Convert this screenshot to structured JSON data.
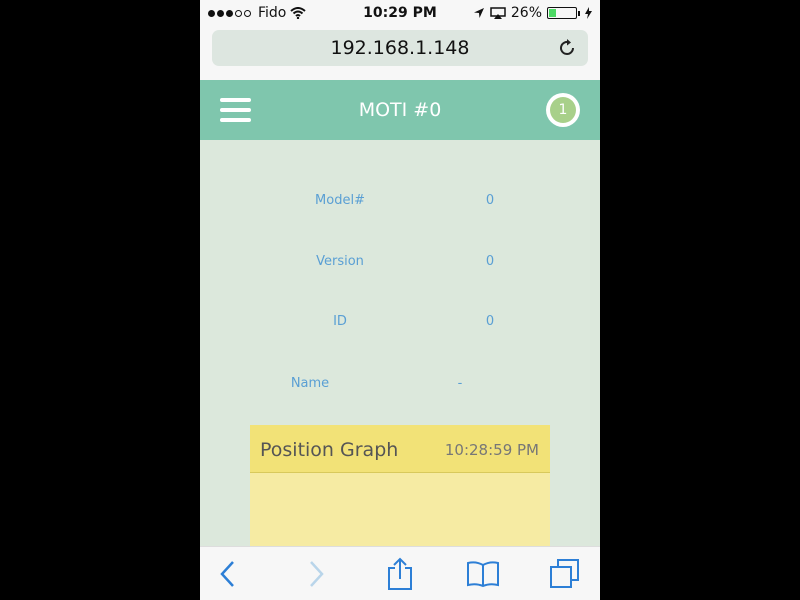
{
  "statusbar": {
    "carrier": "Fido",
    "time": "10:29 PM",
    "battery_percent": "26%",
    "battery_level": 0.26,
    "signal_bars_filled": 3,
    "signal_bars_total": 5
  },
  "browser": {
    "url": "192.168.1.148",
    "icons": {
      "reload": "reload-icon",
      "back": "back-arrow-icon",
      "forward": "forward-arrow-icon",
      "share": "share-icon",
      "bookmarks": "bookmarks-icon",
      "tabs": "tabs-icon"
    }
  },
  "app": {
    "title": "MOTI #0",
    "badge_count": "1",
    "header_color": "#7fc6ad",
    "info": [
      {
        "label": "Model#",
        "value": "0"
      },
      {
        "label": "Version",
        "value": "0"
      },
      {
        "label": "ID",
        "value": "0"
      },
      {
        "label": "Name",
        "value": "-"
      }
    ],
    "card": {
      "title": "Position Graph",
      "time": "10:28:59 PM"
    }
  }
}
